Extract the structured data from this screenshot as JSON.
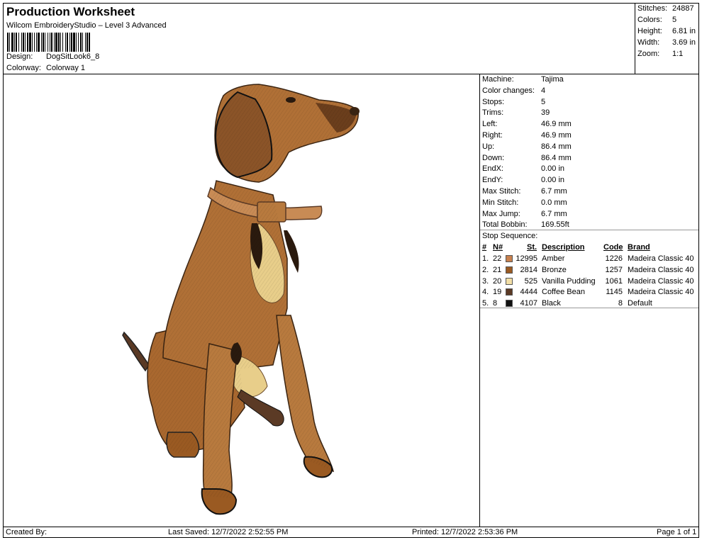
{
  "header": {
    "title": "Production Worksheet",
    "subtitle": "Wilcom EmbroideryStudio – Level 3 Advanced",
    "design_label": "Design:",
    "design_value": "DogSitLook6_8",
    "colorway_label": "Colorway:",
    "colorway_value": "Colorway 1"
  },
  "stats": {
    "stitches_label": "Stitches:",
    "stitches_value": "24887",
    "colors_label": "Colors:",
    "colors_value": "5",
    "height_label": "Height:",
    "height_value": "6.81 in",
    "width_label": "Width:",
    "width_value": "3.69 in",
    "zoom_label": "Zoom:",
    "zoom_value": "1:1"
  },
  "machine": {
    "rows": [
      {
        "label": "Machine:",
        "value": "Tajima"
      },
      {
        "label": "Color changes:",
        "value": "4"
      },
      {
        "label": "Stops:",
        "value": "5"
      },
      {
        "label": "Trims:",
        "value": "39"
      },
      {
        "label": "Left:",
        "value": "46.9 mm"
      },
      {
        "label": "Right:",
        "value": "46.9 mm"
      },
      {
        "label": "Up:",
        "value": "86.4 mm"
      },
      {
        "label": "Down:",
        "value": "86.4 mm"
      },
      {
        "label": "EndX:",
        "value": "0.00 in"
      },
      {
        "label": "EndY:",
        "value": "0.00 in"
      },
      {
        "label": "Max Stitch:",
        "value": "6.7 mm"
      },
      {
        "label": "Min Stitch:",
        "value": "0.0 mm"
      },
      {
        "label": "Max Jump:",
        "value": "6.7 mm"
      },
      {
        "label": "Total Bobbin:",
        "value": "169.55ft"
      }
    ]
  },
  "stop_sequence": {
    "label": "Stop Sequence:",
    "headers": {
      "index": "#",
      "n": "N#",
      "st": "St.",
      "description": "Description",
      "code": "Code",
      "brand": "Brand"
    },
    "rows": [
      {
        "index": "1.",
        "n": "22",
        "color": "#C8814E",
        "st": "12995",
        "description": "Amber",
        "code": "1226",
        "brand": "Madeira Classic 40"
      },
      {
        "index": "2.",
        "n": "21",
        "color": "#9A5A22",
        "st": "2814",
        "description": "Bronze",
        "code": "1257",
        "brand": "Madeira Classic 40"
      },
      {
        "index": "3.",
        "n": "20",
        "color": "#F3DFA6",
        "st": "525",
        "description": "Vanilla Pudding",
        "code": "1061",
        "brand": "Madeira Classic 40"
      },
      {
        "index": "4.",
        "n": "19",
        "color": "#5B3A25",
        "st": "4444",
        "description": "Coffee Bean",
        "code": "1145",
        "brand": "Madeira Classic 40"
      },
      {
        "index": "5.",
        "n": "8",
        "color": "#111111",
        "st": "4107",
        "description": "Black",
        "code": "8",
        "brand": "Default"
      }
    ]
  },
  "footer": {
    "created_by": "Created By:",
    "last_saved": "Last Saved: 12/7/2022 2:52:55 PM",
    "printed": "Printed: 12/7/2022 2:53:36 PM",
    "page": "Page 1 of 1"
  },
  "colors": {
    "amber": "#C8814E",
    "bronze": "#9A5A22",
    "vanilla": "#F3DFA6",
    "coffee": "#5B3A25",
    "black": "#111111"
  }
}
